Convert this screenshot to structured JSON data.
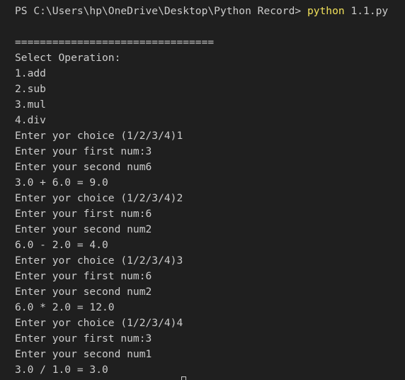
{
  "prompt": {
    "text": "PS C:\\Users\\hp\\OneDrive\\Desktop\\Python Record> ",
    "command": "python",
    "args": " 1.1.py"
  },
  "output_lines": [
    "",
    "================================",
    "Select Operation:",
    "1.add",
    "2.sub",
    "3.mul",
    "4.div",
    "Enter yor choice (1/2/3/4)1",
    "Enter your first num:3",
    "Enter your second num6",
    "3.0 + 6.0 = 9.0",
    "Enter yor choice (1/2/3/4)2",
    "Enter your first num:6",
    "Enter your second num2",
    "6.0 - 2.0 = 4.0",
    "Enter yor choice (1/2/3/4)3",
    "Enter your first num:6",
    "Enter your second num2",
    "6.0 * 2.0 = 12.0",
    "Enter yor choice (1/2/3/4)4",
    "Enter your first num:3",
    "Enter your second num1",
    "3.0 / 1.0 = 3.0"
  ],
  "colors": {
    "background": "#1f1f1f",
    "text": "#cccccc",
    "command": "#f1e05a"
  }
}
